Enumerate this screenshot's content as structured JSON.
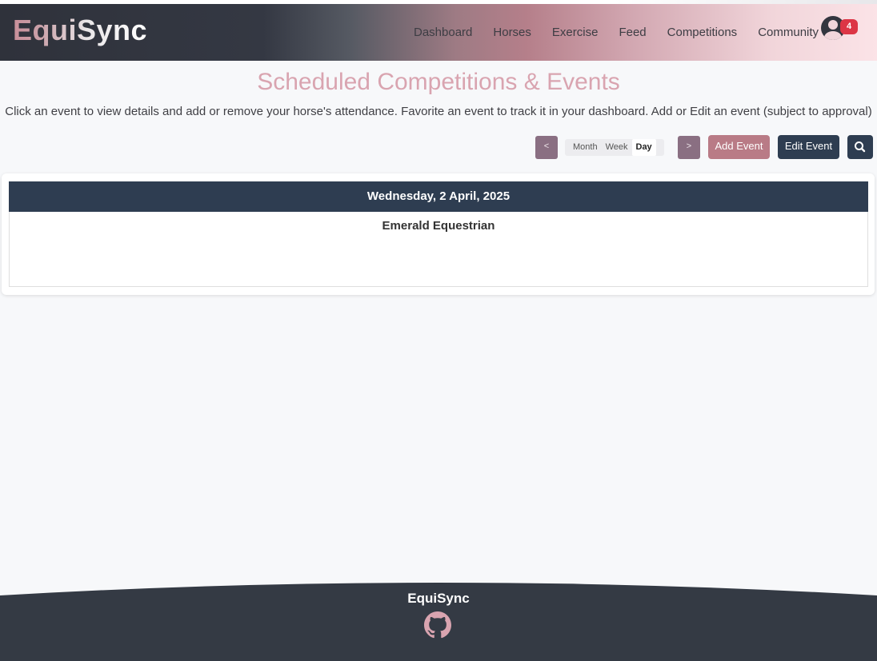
{
  "app": {
    "brand": "EquiSync"
  },
  "nav": {
    "links": [
      "Dashboard",
      "Horses",
      "Exercise",
      "Feed",
      "Competitions",
      "Community"
    ],
    "notification_count": "4"
  },
  "header": {
    "title": "Scheduled Competitions & Events",
    "description": "Click an event to view details and add or remove your horse's attendance. Favorite an event to track it in your dashboard. Add or Edit an event (subject to approval)"
  },
  "toolbar": {
    "prev_label": "<",
    "next_label": ">",
    "views": [
      "Month",
      "Week",
      "Day"
    ],
    "active_view": "Day",
    "add_label": "Add Event",
    "edit_label": "Edit Event",
    "search_icon": "search-icon"
  },
  "calendar": {
    "date_label": "Wednesday, 2 April, 2025",
    "events": [
      "Emerald Equestrian"
    ]
  },
  "footer": {
    "brand": "EquiSync",
    "icon": "github-icon"
  },
  "colors": {
    "accent_pink": "#d9a4b0",
    "rose_button": "#b97b86",
    "navy": "#2e3d51",
    "mauve": "#8a6f82",
    "footer_dark": "#343a44",
    "badge_red": "#dc3545"
  }
}
